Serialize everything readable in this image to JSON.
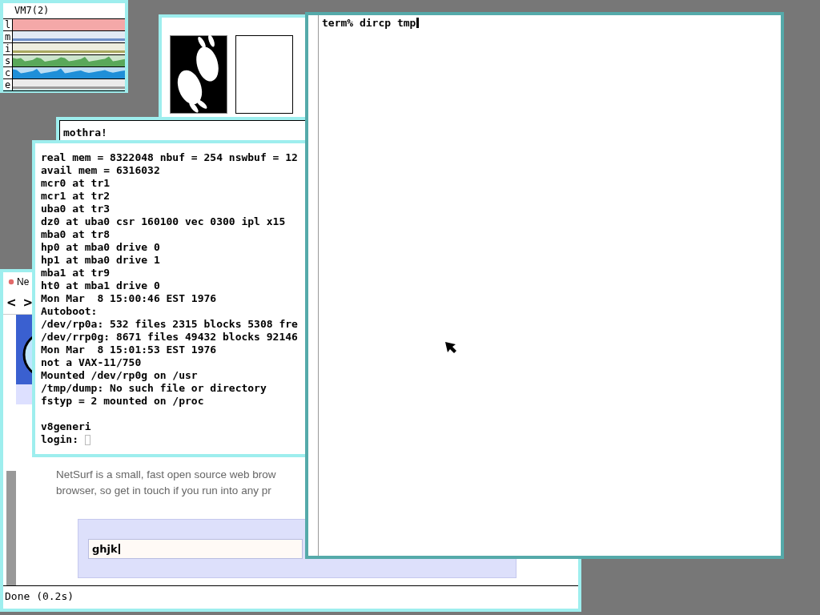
{
  "stats_window": {
    "title": "VM7(2)",
    "active": false,
    "rows": [
      {
        "label": "l",
        "kind": "full",
        "color": "#f4a8a8"
      },
      {
        "label": "m",
        "kind": "flat",
        "color": "#6f8fc8"
      },
      {
        "label": "i",
        "kind": "flat",
        "color": "#a8a860"
      },
      {
        "label": "s",
        "kind": "wave",
        "color": "#5aa85a"
      },
      {
        "label": "c",
        "kind": "wave",
        "color": "#1f8fd8"
      },
      {
        "label": "e",
        "kind": "flat",
        "color": "#9a9a9a"
      }
    ]
  },
  "image_window": {
    "active": false,
    "images": [
      {
        "kind": "picture"
      },
      {
        "kind": "blank"
      }
    ]
  },
  "mothra_window": {
    "active": false,
    "text": "mothra!"
  },
  "console_window": {
    "active": false,
    "lines": [
      "real mem = 8322048 nbuf = 254 nswbuf = 12",
      "avail mem = 6316032",
      "mcr0 at tr1",
      "mcr1 at tr2",
      "uba0 at tr3",
      "dz0 at uba0 csr 160100 vec 0300 ipl x15",
      "mba0 at tr8",
      "hp0 at mba0 drive 0",
      "hp1 at mba0 drive 1",
      "mba1 at tr9",
      "ht0 at mba1 drive 0",
      "Mon Mar  8 15:00:46 EST 1976",
      "Autoboot:",
      "/dev/rp0a: 532 files 2315 blocks 5308 fre",
      "/dev/rrp0g: 8671 files 49432 blocks 92146",
      "Mon Mar  8 15:01:53 EST 1976",
      "not a VAX-11/750",
      "Mounted /dev/rp0g on /usr",
      "/tmp/dump: No such file or directory",
      "fstyp = 2 mounted on /proc"
    ],
    "hostname": "v8generi",
    "prompt": "login:"
  },
  "browser_window": {
    "active": false,
    "title": "Ne",
    "nav_buttons": [
      "<",
      ">"
    ],
    "paragraph_lines": [
      "NetSurf is a small, fast open source web brow",
      "browser, so get in touch if you run into any pr"
    ],
    "search_value": "ghjk",
    "status": "Done (0.2s)"
  },
  "terminal_window": {
    "active": true,
    "text": "term% dircp tmp"
  }
}
